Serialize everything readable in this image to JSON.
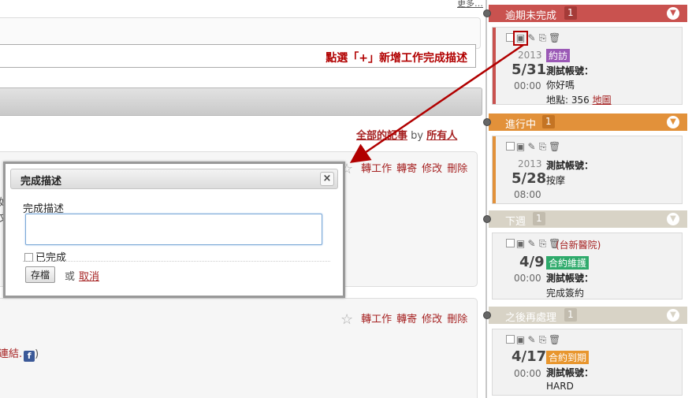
{
  "main": {
    "more_link": "更多…",
    "instruction": "點選「+」新增工作完成描述",
    "filter": {
      "all_notes": "全部的記事",
      "by": "by",
      "everyone": "所有人"
    },
    "entry_actions": {
      "forward_task": "轉工作",
      "forward_mail": "轉寄",
      "edit": "修改",
      "delete": "刪除"
    },
    "fragments": {
      "link_text": "連結.",
      "fb": "f",
      "close_paren": ")",
      "frag1": "如",
      "frag2": "文"
    }
  },
  "dialog": {
    "title": "完成描述",
    "close_symbol": "×",
    "field_label": "完成描述",
    "field_value": "",
    "done_label": "已完成",
    "save_button": "存檔",
    "or_text": "或",
    "cancel_link": "取消"
  },
  "sidebar": {
    "sections": [
      {
        "title": "逾期未完成",
        "count": "1",
        "color": "#c9524f"
      },
      {
        "title": "進行中",
        "count": "1",
        "color": "#e2913a"
      },
      {
        "title": "下週",
        "count": "1",
        "color": "#d8d3c6"
      },
      {
        "title": "之後再處理",
        "count": "1",
        "color": "#d8d3c6"
      }
    ],
    "events": [
      {
        "year": "2013",
        "date": "5/31",
        "time": "00:00",
        "tag": "約訪",
        "tag_color": "#9b59b6",
        "account": "測試帳號：",
        "line1": "你好嗎",
        "loc_label": "地點: 356",
        "map_link": "地圖"
      },
      {
        "year": "2013",
        "date": "5/28",
        "time": "08:00",
        "account": "測試帳號：",
        "line1": "按摩"
      },
      {
        "extra": "(台新醫院)",
        "date": "4/9",
        "time": "00:00",
        "tag": "合約維護",
        "tag_color": "#2eaa6b",
        "account": "測試帳號：",
        "line1": "完成簽約"
      },
      {
        "date": "4/17",
        "time": "00:00",
        "tag": "合約到期",
        "tag_color": "#e8962e",
        "account": "測試帳號：",
        "line1": "HARD"
      }
    ]
  },
  "icons": {
    "checkbox": "☐",
    "add_note": "💬",
    "edit": "✎",
    "copy": "⎘",
    "trash": "🗑",
    "star": "☆",
    "chevron": "▼"
  }
}
